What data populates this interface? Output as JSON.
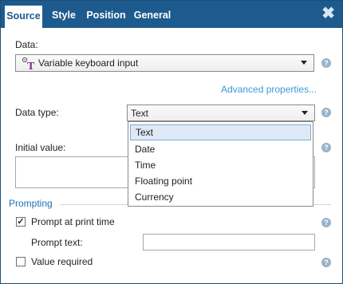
{
  "tabs": [
    {
      "label": "Source",
      "active": true
    },
    {
      "label": "Style",
      "active": false
    },
    {
      "label": "Position",
      "active": false
    },
    {
      "label": "General",
      "active": false
    }
  ],
  "close_label": "✖",
  "data_section": {
    "label": "Data:",
    "selected": "Variable keyboard input",
    "icon": "variable-text-icon",
    "help": "?"
  },
  "advanced_link": "Advanced properties...",
  "data_type": {
    "label": "Data type:",
    "selected": "Text",
    "options": [
      "Text",
      "Date",
      "Time",
      "Floating point",
      "Currency"
    ],
    "highlighted_index": 0,
    "help": "?"
  },
  "initial_value": {
    "label": "Initial value:",
    "value": "",
    "help": "?"
  },
  "prompting": {
    "title": "Prompting",
    "prompt_at_print": {
      "label": "Prompt at print time",
      "checked": true,
      "help": "?"
    },
    "prompt_text": {
      "label": "Prompt text:",
      "value": ""
    },
    "value_required": {
      "label": "Value required",
      "checked": false,
      "help": "?"
    }
  },
  "colors": {
    "titlebar": "#1d5b8e",
    "accent": "#1d73b5",
    "link": "#3a9ad6",
    "highlight": "#dfe9f6"
  }
}
